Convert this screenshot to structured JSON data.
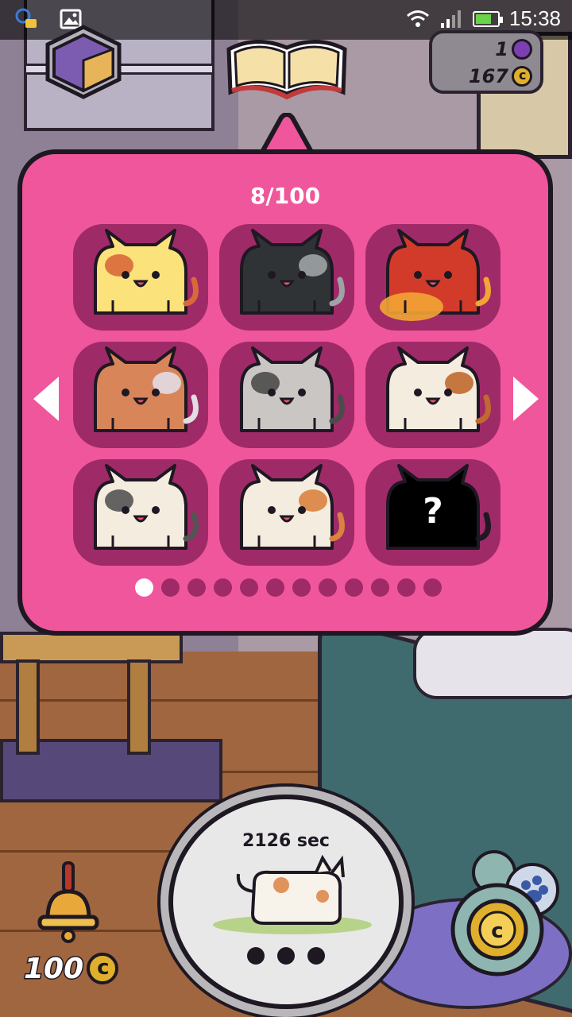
{
  "status_bar": {
    "time": "15:38",
    "icons": [
      "notification-app-icon",
      "image-icon",
      "wifi-icon",
      "signal-icon",
      "battery-icon"
    ],
    "battery_percent": 75
  },
  "hud": {
    "room_button_icon": "room-cube-icon",
    "book_button_icon": "open-book-icon",
    "gems": "1",
    "coins": "167"
  },
  "collection": {
    "counter": "8/100",
    "cats": [
      {
        "name": "yellow-tabby",
        "discovered": true,
        "body": "#fbe27a",
        "accent": "#d9693b"
      },
      {
        "name": "black-white-muzzle",
        "discovered": true,
        "body": "#2f3336",
        "accent": "#9ea3a6"
      },
      {
        "name": "red-orange-belly",
        "discovered": true,
        "body": "#d23b2a",
        "accent": "#f2a534"
      },
      {
        "name": "orange-white-patch",
        "discovered": true,
        "body": "#d9855a",
        "accent": "#e2dde3"
      },
      {
        "name": "grey-masked",
        "discovered": true,
        "body": "#c9c6c4",
        "accent": "#4b4b4b"
      },
      {
        "name": "white-brown-eye",
        "discovered": true,
        "body": "#f4ecdf",
        "accent": "#c06a2f"
      },
      {
        "name": "white-bowtie",
        "discovered": true,
        "body": "#f4ecdf",
        "accent": "#545454"
      },
      {
        "name": "calico",
        "discovered": true,
        "body": "#f4ecdf",
        "accent": "#d9833f"
      },
      {
        "name": "unknown",
        "discovered": false,
        "body": "#000000",
        "accent": "#ffffff",
        "label": "?"
      }
    ],
    "pages_total": 12,
    "current_page": 1
  },
  "bottom": {
    "bell_cost": "100",
    "timer_text": "2126 sec",
    "shop_icon": "coin-paw-icon"
  },
  "colors": {
    "popup_bg": "#f0569b",
    "cell_bg": "#9f2a68",
    "outline": "#1e1822"
  }
}
